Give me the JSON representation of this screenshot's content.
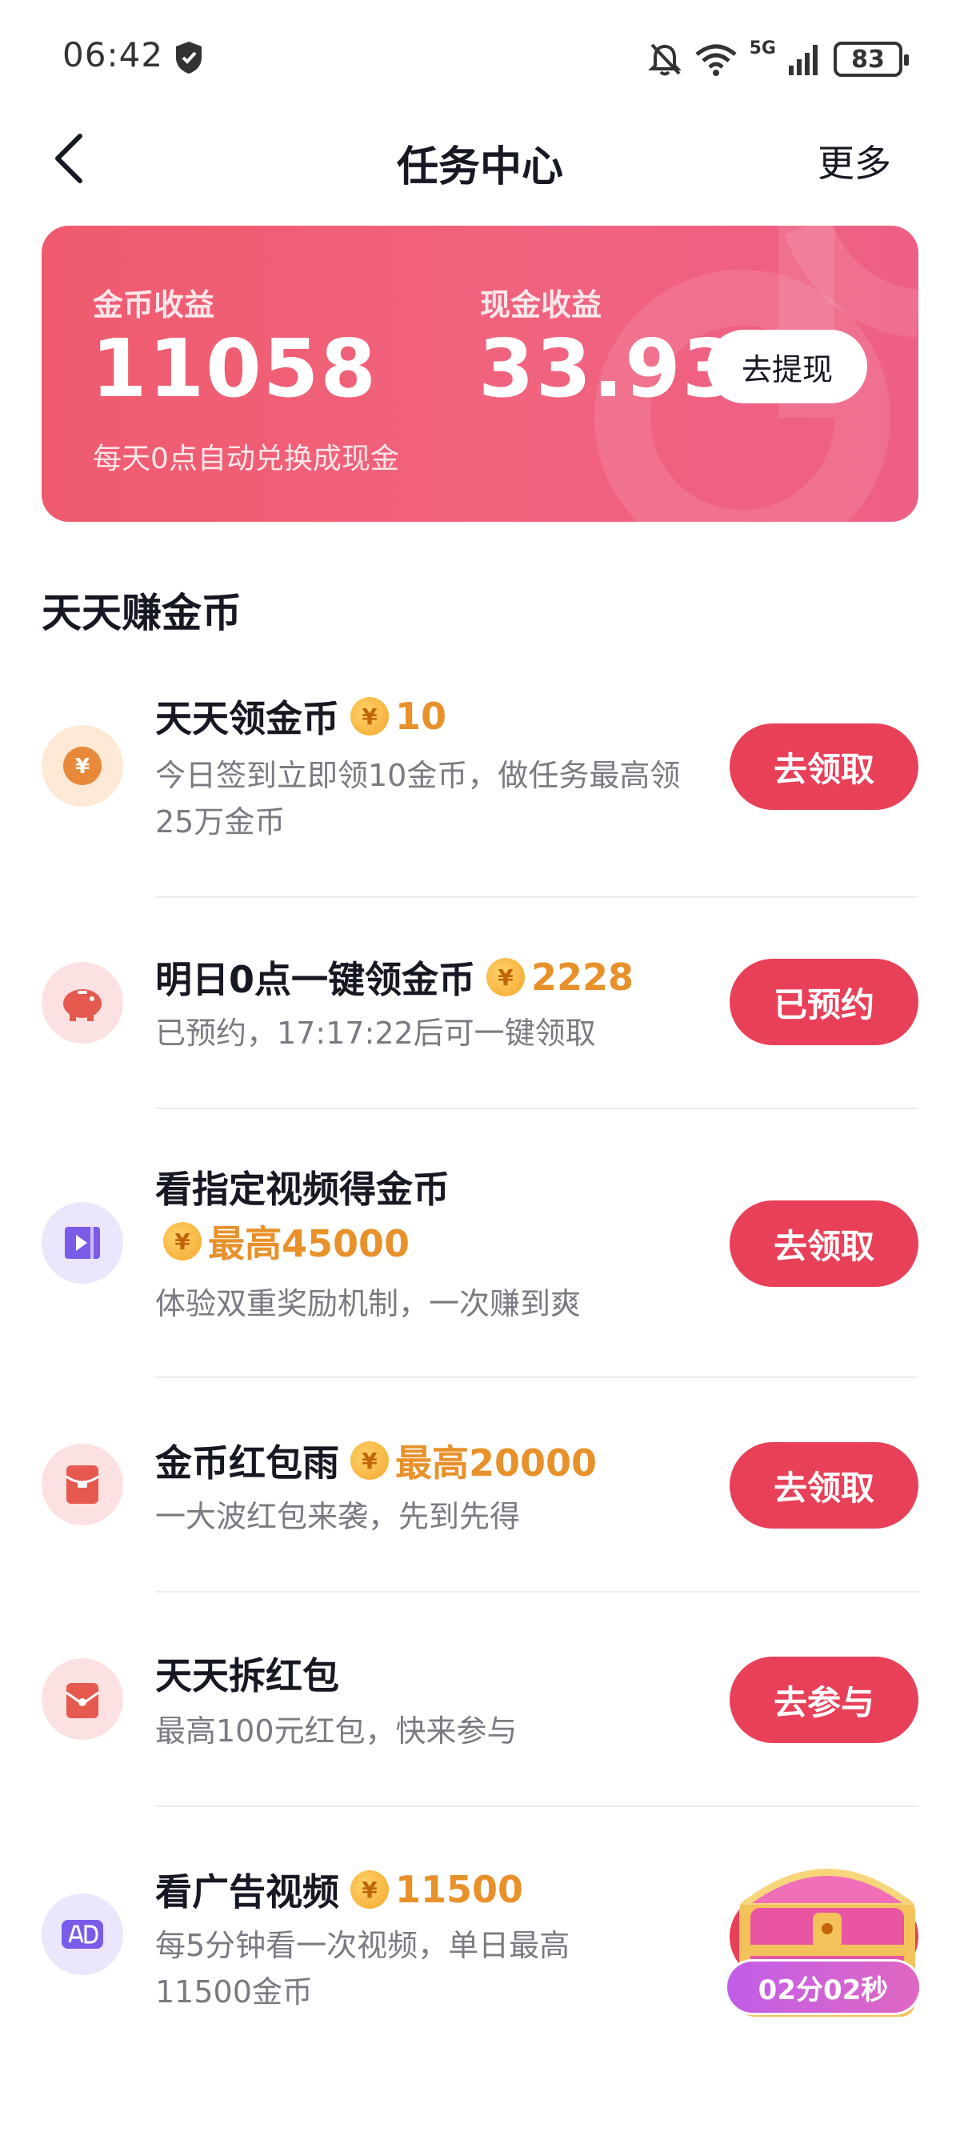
{
  "status_bar": {
    "time": "06:42",
    "battery": "83",
    "network": "5G"
  },
  "nav": {
    "title": "任务中心",
    "more": "更多"
  },
  "earnings": {
    "coin_label": "金币收益",
    "coin_value": "11058",
    "cash_label": "现金收益",
    "cash_value": "33.93",
    "withdraw_label": "去提现",
    "note": "每天0点自动兑换成现金"
  },
  "section": {
    "title": "天天赚金币"
  },
  "tasks": [
    {
      "title": "天天领金币",
      "reward": "10",
      "desc": "今日签到立即领10金币，做任务最高领25万金币",
      "button": "去领取",
      "icon": "yen-coin-icon"
    },
    {
      "title": "明日0点一键领金币",
      "reward": "2228",
      "desc": "已预约，17:17:22后可一键领取",
      "button": "已预约",
      "icon": "piggy-bank-icon"
    },
    {
      "title": "看指定视频得金币",
      "reward": "最高45000",
      "desc": "体验双重奖励机制，一次赚到爽",
      "button": "去领取",
      "icon": "video-icon"
    },
    {
      "title": "金币红包雨",
      "reward": "最高20000",
      "desc": "一大波红包来袭，先到先得",
      "button": "去领取",
      "icon": "red-envelope-icon"
    },
    {
      "title": "天天拆红包",
      "reward": "",
      "desc": "最高100元红包，快来参与",
      "button": "去参与",
      "icon": "open-envelope-icon"
    },
    {
      "title": "看广告视频",
      "reward": "11500",
      "desc": "每5分钟看一次视频，单日最高11500金币",
      "button": "",
      "icon": "ad-icon"
    }
  ],
  "coin_symbol": "¥",
  "treasure": {
    "timer": "02分02秒"
  },
  "colors": {
    "accent": "#e84058",
    "reward": "#e8912a",
    "card_start": "#ef5a6e",
    "card_end": "#ee5f86"
  }
}
